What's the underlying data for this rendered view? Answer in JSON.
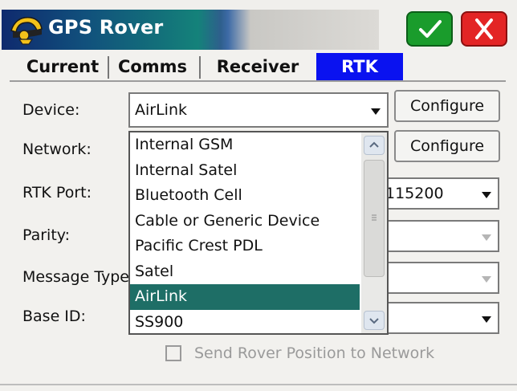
{
  "window": {
    "title": "GPS Rover"
  },
  "tabs": [
    {
      "label": "Current",
      "active": false
    },
    {
      "label": "Comms",
      "active": false
    },
    {
      "label": "Receiver",
      "active": false
    },
    {
      "label": "RTK",
      "active": true
    }
  ],
  "form": {
    "device": {
      "label": "Device:",
      "value": "AirLink",
      "button": "Configure"
    },
    "network": {
      "label": "Network:",
      "button": "Configure"
    },
    "rtk_port": {
      "label": "RTK Port:",
      "value": "115200"
    },
    "parity": {
      "label": "Parity:"
    },
    "message_type": {
      "label": "Message Type:"
    },
    "base_id": {
      "label": "Base ID:"
    },
    "send_rover": {
      "label": "Send Rover Position to Network",
      "checked": false
    }
  },
  "dropdown": {
    "options": [
      "Internal GSM",
      "Internal Satel",
      "Bluetooth Cell",
      "Cable or Generic Device",
      "Pacific Crest PDL",
      "Satel",
      "AirLink",
      "SS900"
    ],
    "selected": "AirLink"
  },
  "colors": {
    "active_tab": "#0a12f0",
    "selected_option": "#1e6e66",
    "ok": "#1a9c2c",
    "close": "#e32525"
  }
}
